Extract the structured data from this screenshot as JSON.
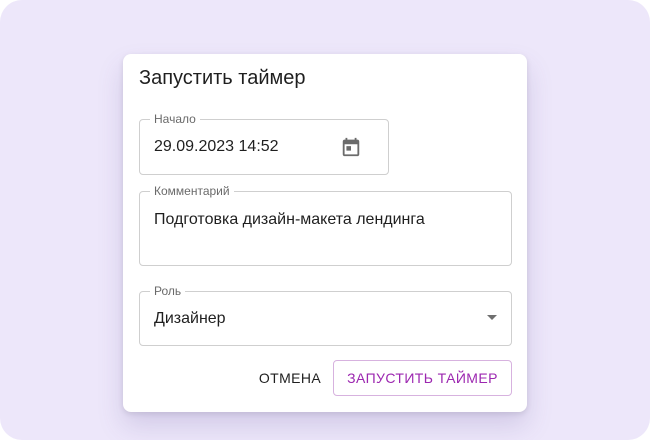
{
  "dialog": {
    "title": "Запустить таймер",
    "fields": {
      "start": {
        "label": "Начало",
        "value": "29.09.2023 14:52",
        "icon": "calendar-icon"
      },
      "comment": {
        "label": "Комментарий",
        "value": "Подготовка дизайн-макета лендинга"
      },
      "role": {
        "label": "Роль",
        "value": "Дизайнер",
        "icon": "dropdown-arrow-icon"
      }
    },
    "actions": {
      "cancel_label": "Отмена",
      "start_label": "Запустить таймер"
    }
  },
  "colors": {
    "background": "#ede7fa",
    "accent": "#9c27b0",
    "border": "#cfcfcf"
  }
}
